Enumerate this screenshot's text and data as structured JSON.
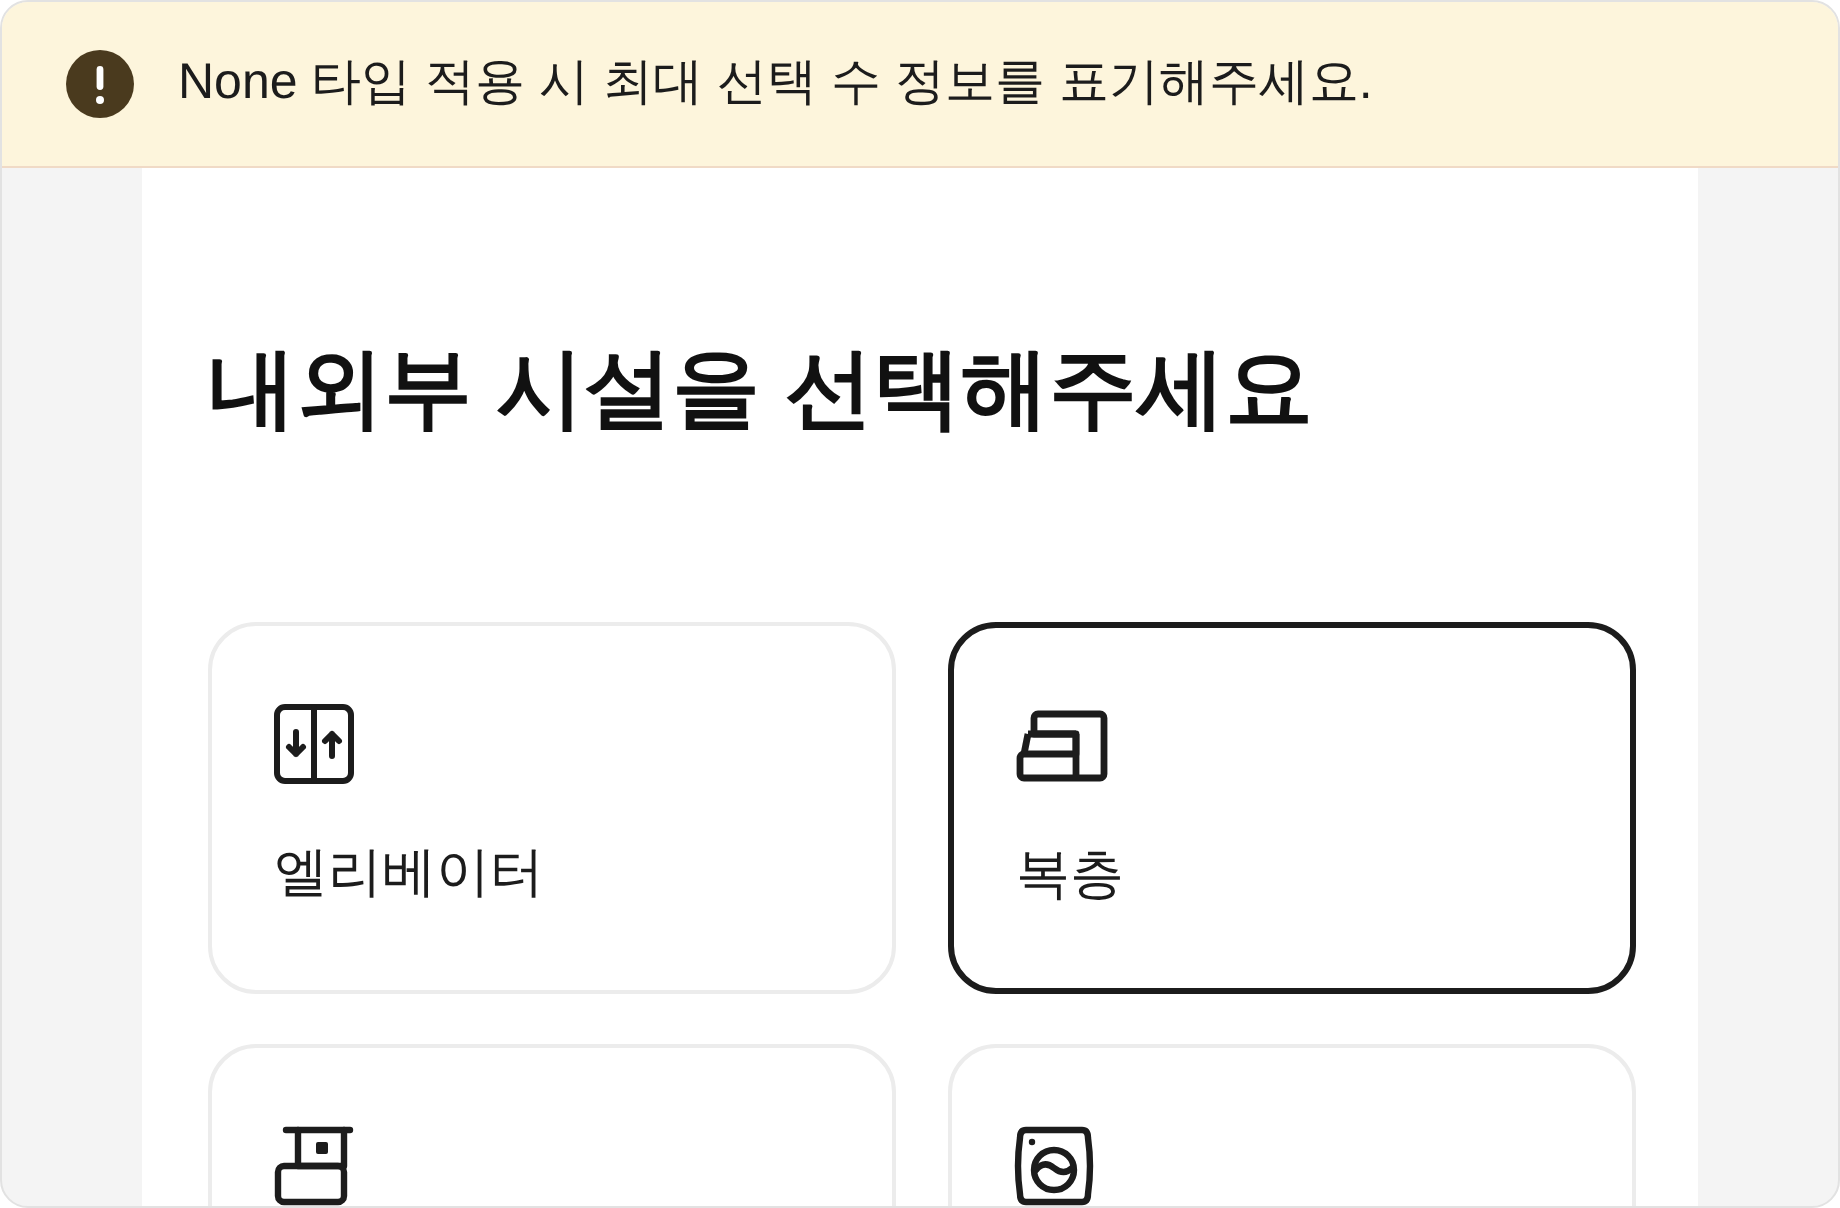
{
  "banner": {
    "text": "None 타입 적용 시 최대 선택 수 정보를 표기해주세요."
  },
  "heading": "내외부 시설을 선택해주세요",
  "facilities": [
    {
      "label": "엘리베이터",
      "selected": false
    },
    {
      "label": "복층",
      "selected": true
    },
    {
      "selected": false
    },
    {
      "selected": false
    }
  ]
}
